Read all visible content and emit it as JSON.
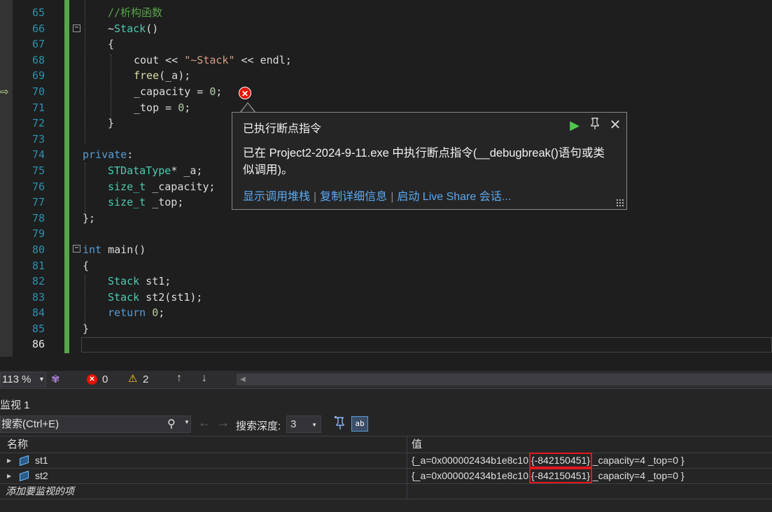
{
  "editor": {
    "line_numbers": [
      "65",
      "66",
      "67",
      "68",
      "69",
      "70",
      "71",
      "72",
      "73",
      "74",
      "75",
      "76",
      "77",
      "78",
      "79",
      "80",
      "81",
      "82",
      "83",
      "84",
      "85",
      "86"
    ],
    "current_line": "86",
    "code": {
      "l65": "//析构函数",
      "l66_tilde": "~",
      "l66_name": "Stack",
      "l66_paren": "()",
      "l67": "{",
      "l68_a": "cout << ",
      "l68_str": "\"~Stack\"",
      "l68_b": " << endl;",
      "l69_fn": "free",
      "l69_rest": "(_a);",
      "l70_a": "_capacity = ",
      "l70_num": "0",
      "l70_b": ";",
      "l71_a": "_top = ",
      "l71_num": "0",
      "l71_b": ";",
      "l72": "}",
      "l74_kw": "private",
      "l74_colon": ":",
      "l75_type": "STDataType",
      "l75_rest": "* _a;",
      "l76_type": "size_t",
      "l76_rest": " _capacity;",
      "l77_type": "size_t",
      "l77_rest": " _top;",
      "l78": "};",
      "l80_kw": "int",
      "l80_rest": " main()",
      "l81": "{",
      "l82_type": "Stack",
      "l82_rest": " st1;",
      "l83_type": "Stack",
      "l83_rest": " st2(st1);",
      "l84_kw": "return",
      "l84_num": "0",
      "l84_b": ";",
      "l85": "}"
    }
  },
  "exception_popup": {
    "title": "已执行断点指令",
    "message": "已在 Project2-2024-9-11.exe 中执行断点指令(__debugbreak()语句或类似调用)。",
    "links": [
      "显示调用堆栈",
      "复制详细信息",
      "启动 Live Share 会话..."
    ],
    "continue_icon": "▶",
    "pin_icon": "⚲",
    "close_icon": "✕"
  },
  "statusbar": {
    "zoom": "113 %",
    "errors": "0",
    "warnings": "2"
  },
  "watch": {
    "title": "监视 1",
    "search_placeholder": "搜索(Ctrl+E)",
    "depth_label": "搜索深度:",
    "depth_value": "3",
    "columns": {
      "name": "名称",
      "value": "值"
    },
    "rows": [
      {
        "name": "st1",
        "value_pre": "{_a=0x000002434b1e8c10 ",
        "value_hl": "{-842150451}",
        "value_post": " _capacity=4 _top=0 }"
      },
      {
        "name": "st2",
        "value_pre": "{_a=0x000002434b1e8c10 ",
        "value_hl": "{-842150451}",
        "value_post": " _capacity=4 _top=0 }"
      }
    ],
    "add_item_placeholder": "添加要监视的项"
  },
  "colors": {
    "editor_bg": "#1e1e1e",
    "keyword": "#569cd6",
    "type": "#4ec9b0",
    "comment": "#57a64a",
    "string": "#d69d85",
    "link": "#5aa9f2",
    "error": "#e51400",
    "highlight_box": "#e0191f"
  }
}
